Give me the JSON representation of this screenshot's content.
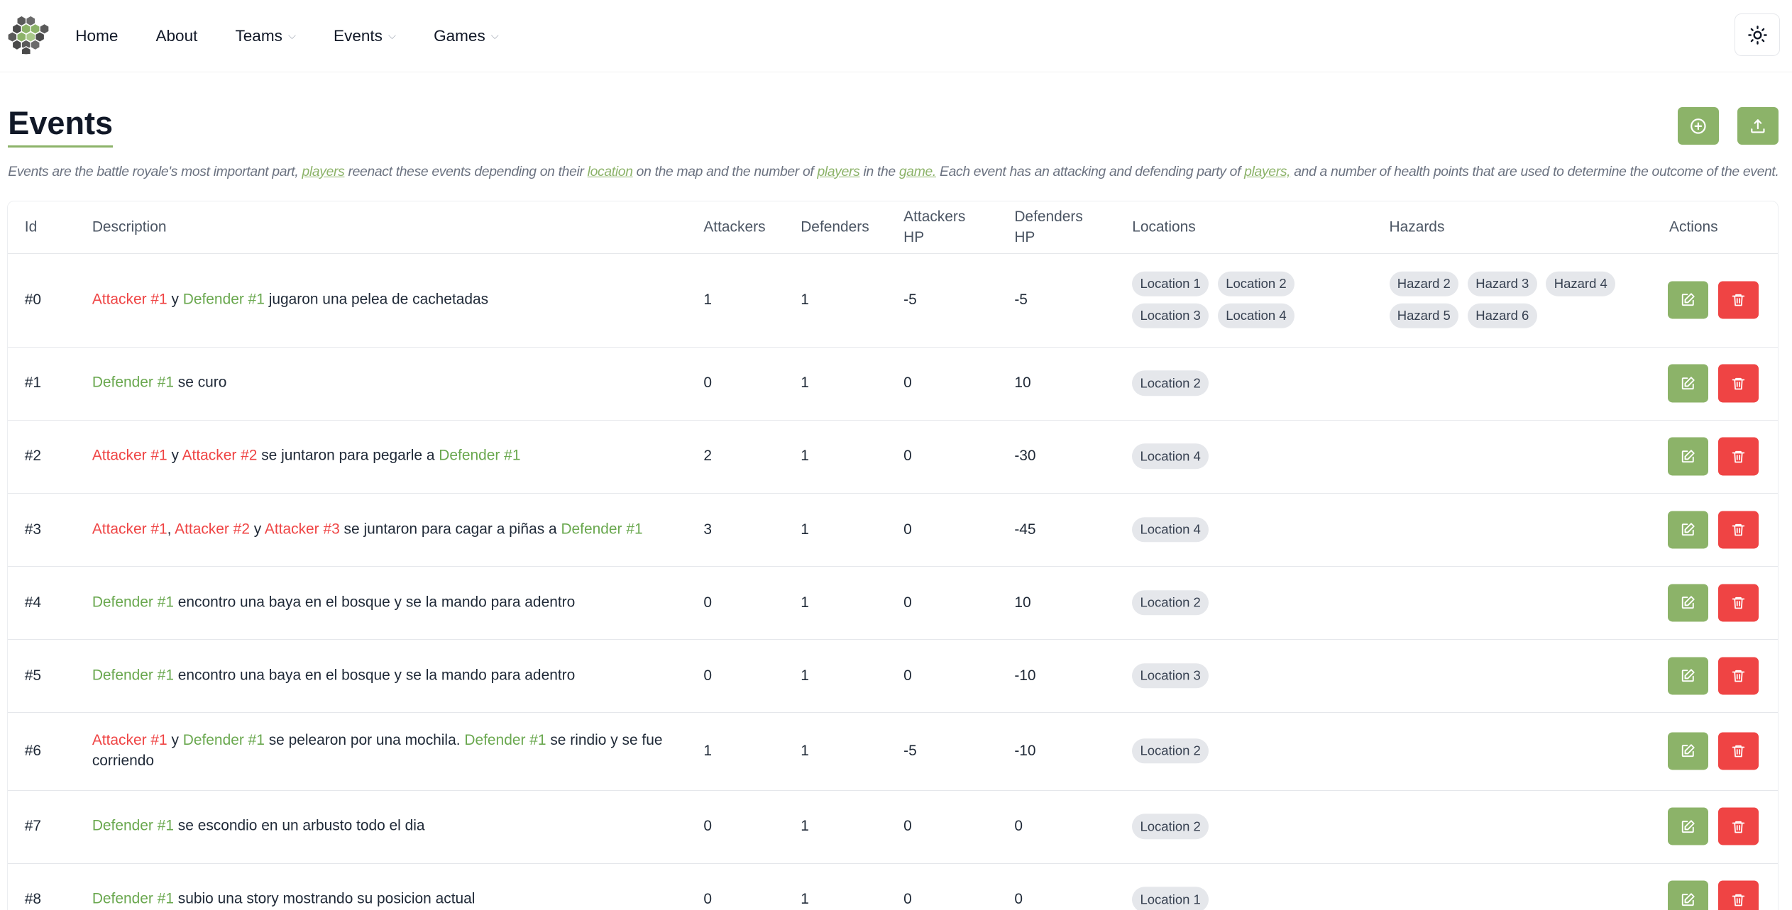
{
  "nav": {
    "home": "Home",
    "about": "About",
    "teams": "Teams",
    "events": "Events",
    "games": "Games"
  },
  "page": {
    "title": "Events",
    "description": [
      {
        "t": "Events are the battle royale's most important part, ",
        "link": false
      },
      {
        "t": "players",
        "link": true
      },
      {
        "t": " reenact these events depending on their ",
        "link": false
      },
      {
        "t": "location",
        "link": true
      },
      {
        "t": " on the map and the number of ",
        "link": false
      },
      {
        "t": "players",
        "link": true
      },
      {
        "t": " in the ",
        "link": false
      },
      {
        "t": "game.",
        "link": true
      },
      {
        "t": " Each event has an attacking and defending party of ",
        "link": false
      },
      {
        "t": "players,",
        "link": true
      },
      {
        "t": " and a number of health points that are used to determine the outcome of the event.",
        "link": false
      }
    ]
  },
  "colors": {
    "accent": "#8cb369",
    "danger": "#ef4444",
    "attacker": "#ef4444",
    "defender": "#6aa84f"
  },
  "table": {
    "headers": {
      "id": "Id",
      "description": "Description",
      "attackers": "Attackers",
      "defenders": "Defenders",
      "attackers_hp": [
        "Attackers",
        "HP"
      ],
      "defenders_hp": [
        "Defenders",
        "HP"
      ],
      "locations": "Locations",
      "hazards": "Hazards",
      "actions": "Actions"
    },
    "rows": [
      {
        "id": "#0",
        "desc": [
          {
            "t": "Attacker #1",
            "k": "atk"
          },
          {
            "t": " y "
          },
          {
            "t": "Defender #1",
            "k": "def"
          },
          {
            "t": " jugaron una pelea de cachetadas"
          }
        ],
        "attackers": "1",
        "defenders": "1",
        "attackers_hp": "-5",
        "defenders_hp": "-5",
        "locations": [
          "Location 1",
          "Location 2",
          "Location 3",
          "Location 4"
        ],
        "hazards": [
          "Hazard 2",
          "Hazard 3",
          "Hazard 4",
          "Hazard 5",
          "Hazard 6"
        ]
      },
      {
        "id": "#1",
        "desc": [
          {
            "t": "Defender #1",
            "k": "def"
          },
          {
            "t": " se curo"
          }
        ],
        "attackers": "0",
        "defenders": "1",
        "attackers_hp": "0",
        "defenders_hp": "10",
        "locations": [
          "Location 2"
        ],
        "hazards": []
      },
      {
        "id": "#2",
        "desc": [
          {
            "t": "Attacker #1",
            "k": "atk"
          },
          {
            "t": " y "
          },
          {
            "t": "Attacker #2",
            "k": "atk"
          },
          {
            "t": " se juntaron para pegarle a "
          },
          {
            "t": "Defender #1",
            "k": "def"
          }
        ],
        "attackers": "2",
        "defenders": "1",
        "attackers_hp": "0",
        "defenders_hp": "-30",
        "locations": [
          "Location 4"
        ],
        "hazards": []
      },
      {
        "id": "#3",
        "desc": [
          {
            "t": "Attacker #1",
            "k": "atk"
          },
          {
            "t": ", "
          },
          {
            "t": "Attacker #2",
            "k": "atk"
          },
          {
            "t": " y "
          },
          {
            "t": "Attacker #3",
            "k": "atk"
          },
          {
            "t": " se juntaron para cagar a piñas a "
          },
          {
            "t": "Defender #1",
            "k": "def"
          }
        ],
        "attackers": "3",
        "defenders": "1",
        "attackers_hp": "0",
        "defenders_hp": "-45",
        "locations": [
          "Location 4"
        ],
        "hazards": []
      },
      {
        "id": "#4",
        "desc": [
          {
            "t": "Defender #1",
            "k": "def"
          },
          {
            "t": " encontro una baya en el bosque y se la mando para adentro"
          }
        ],
        "attackers": "0",
        "defenders": "1",
        "attackers_hp": "0",
        "defenders_hp": "10",
        "locations": [
          "Location 2"
        ],
        "hazards": []
      },
      {
        "id": "#5",
        "desc": [
          {
            "t": "Defender #1",
            "k": "def"
          },
          {
            "t": " encontro una baya en el bosque y se la mando para adentro"
          }
        ],
        "attackers": "0",
        "defenders": "1",
        "attackers_hp": "0",
        "defenders_hp": "-10",
        "locations": [
          "Location 3"
        ],
        "hazards": []
      },
      {
        "id": "#6",
        "desc": [
          {
            "t": "Attacker #1",
            "k": "atk"
          },
          {
            "t": " y "
          },
          {
            "t": "Defender #1",
            "k": "def"
          },
          {
            "t": " se pelearon por una mochila. "
          },
          {
            "t": "Defender #1",
            "k": "def"
          },
          {
            "t": " se rindio y se fue corriendo"
          }
        ],
        "attackers": "1",
        "defenders": "1",
        "attackers_hp": "-5",
        "defenders_hp": "-10",
        "locations": [
          "Location 2"
        ],
        "hazards": []
      },
      {
        "id": "#7",
        "desc": [
          {
            "t": "Defender #1",
            "k": "def"
          },
          {
            "t": " se escondio en un arbusto todo el dia"
          }
        ],
        "attackers": "0",
        "defenders": "1",
        "attackers_hp": "0",
        "defenders_hp": "0",
        "locations": [
          "Location 2"
        ],
        "hazards": []
      },
      {
        "id": "#8",
        "desc": [
          {
            "t": "Defender #1",
            "k": "def"
          },
          {
            "t": " subio una story mostrando su posicion actual"
          }
        ],
        "attackers": "0",
        "defenders": "1",
        "attackers_hp": "0",
        "defenders_hp": "0",
        "locations": [
          "Location 1"
        ],
        "hazards": []
      }
    ]
  }
}
